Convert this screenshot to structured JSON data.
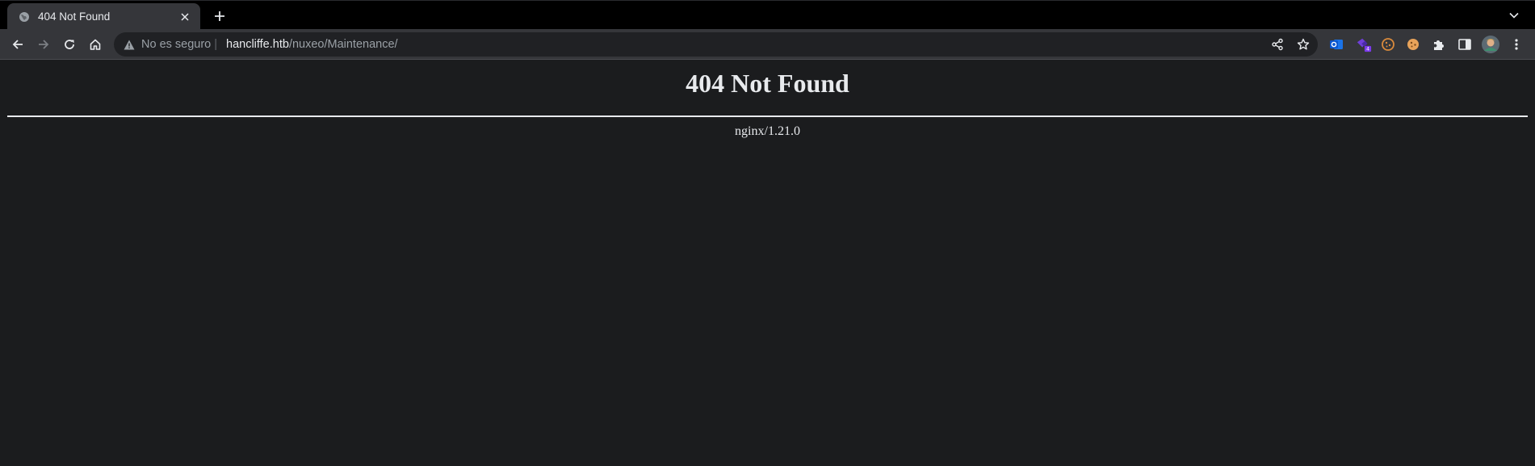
{
  "browser": {
    "tab": {
      "title": "404 Not Found",
      "favicon": "globe-icon"
    },
    "toolbar": {
      "security_label": "No es seguro",
      "url_host": "hancliffe.htb",
      "url_path": "/nuxeo/Maintenance/",
      "badge_count": "4"
    },
    "colors": {
      "tabstrip_bg": "#000000",
      "toolbar_bg": "#35363a",
      "omnibox_bg": "#202124",
      "page_bg": "#1b1c1e",
      "text": "#e8eaed",
      "muted_text": "#9aa0a6"
    }
  },
  "page": {
    "heading": "404 Not Found",
    "server": "nginx/1.21.0"
  }
}
